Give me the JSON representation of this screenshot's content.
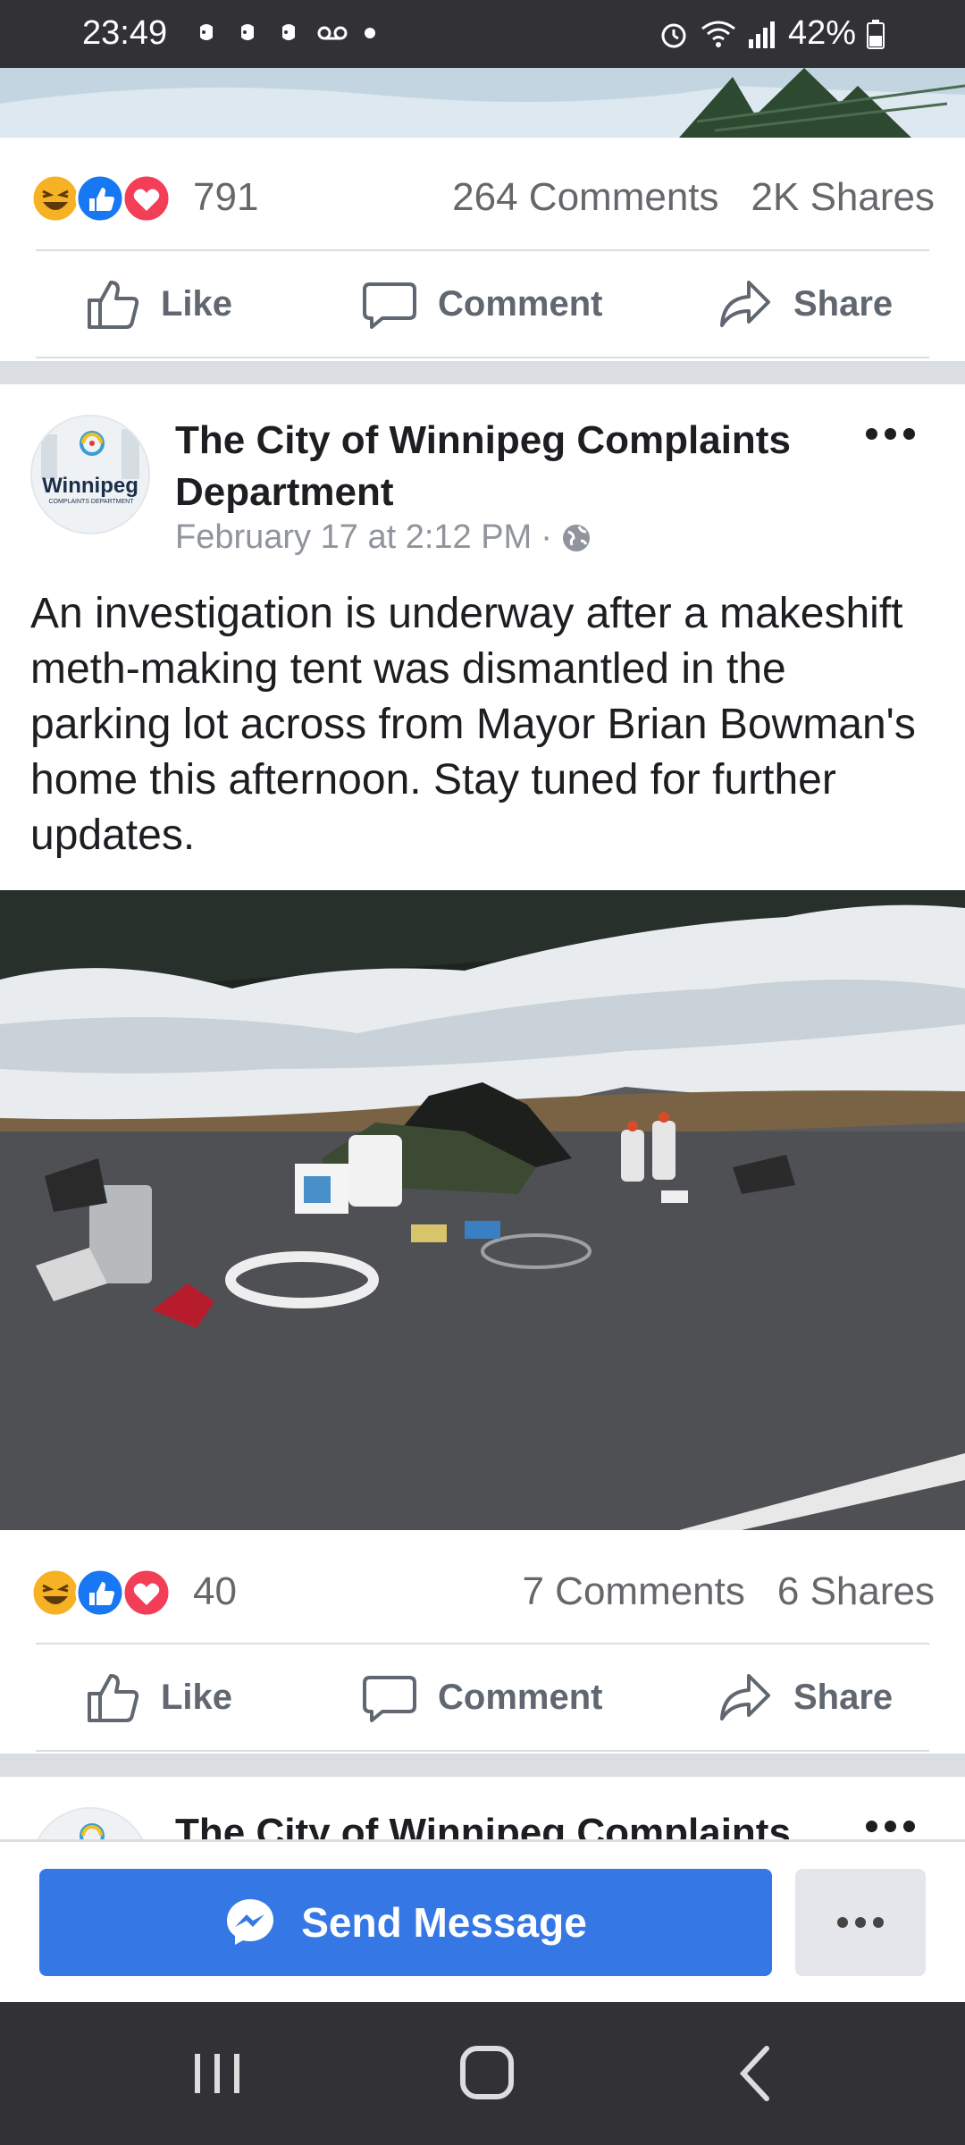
{
  "status_bar": {
    "time": "23:49",
    "battery": "42%"
  },
  "posts": [
    {
      "reaction_count": "791",
      "comments": "264 Comments",
      "shares": "2K Shares",
      "actions": {
        "like": "Like",
        "comment": "Comment",
        "share": "Share"
      }
    },
    {
      "page_name": "The City of Winnipeg Complaints Department",
      "avatar_text": "Winnipeg",
      "avatar_subtext": "COMPLAINTS DEPARTMENT",
      "timestamp": "February 17 at 2:12 PM",
      "text": "An investigation is underway after a makeshift meth-making tent was dismantled in the parking lot across from Mayor Brian Bowman's home this afternoon. Stay tuned for further updates.",
      "reaction_count": "40",
      "comments": "7 Comments",
      "shares": "6 Shares",
      "actions": {
        "like": "Like",
        "comment": "Comment",
        "share": "Share"
      }
    },
    {
      "page_name": "The City of Winnipeg Complaints"
    }
  ],
  "bottom_bar": {
    "send_message": "Send Message"
  },
  "colors": {
    "accent": "#3578e5",
    "text": "#1c1e21",
    "muted": "#65676b",
    "divider": "#dadde1",
    "status_bar": "#323236"
  },
  "icons": [
    "laugh-icon",
    "like-icon",
    "love-icon",
    "thumbs-up-icon",
    "comment-icon",
    "share-icon",
    "globe-icon",
    "messenger-icon",
    "more-icon"
  ]
}
